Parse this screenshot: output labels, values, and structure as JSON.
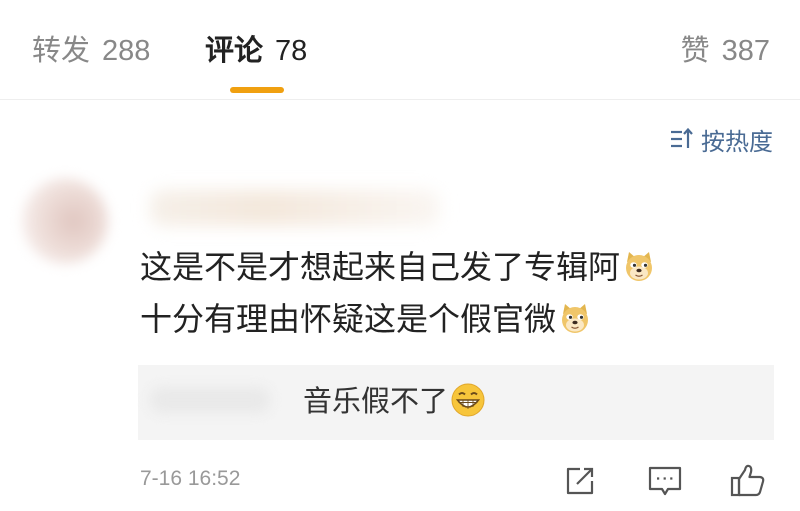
{
  "tabs": {
    "repost": {
      "label": "转发",
      "count": "288"
    },
    "comments": {
      "label": "评论",
      "count": "78"
    },
    "likes": {
      "label": "赞",
      "count": "387"
    }
  },
  "sort_label": "按热度",
  "comment": {
    "line1": "这是不是才想起来自己发了专辑阿",
    "line2": "十分有理由怀疑这是个假官微",
    "emoji": "doge-emoji"
  },
  "reply": {
    "text": "音乐假不了",
    "emoji": "grin-emoji"
  },
  "timestamp": "7-16  16:52",
  "icons": {
    "repost": "share-icon",
    "comment": "comment-icon",
    "like": "thumbs-up-icon",
    "sort": "sort-icon"
  },
  "colors": {
    "accent": "#f0a010",
    "link": "#4a6b94",
    "reply_bg": "#f4f4f4"
  }
}
